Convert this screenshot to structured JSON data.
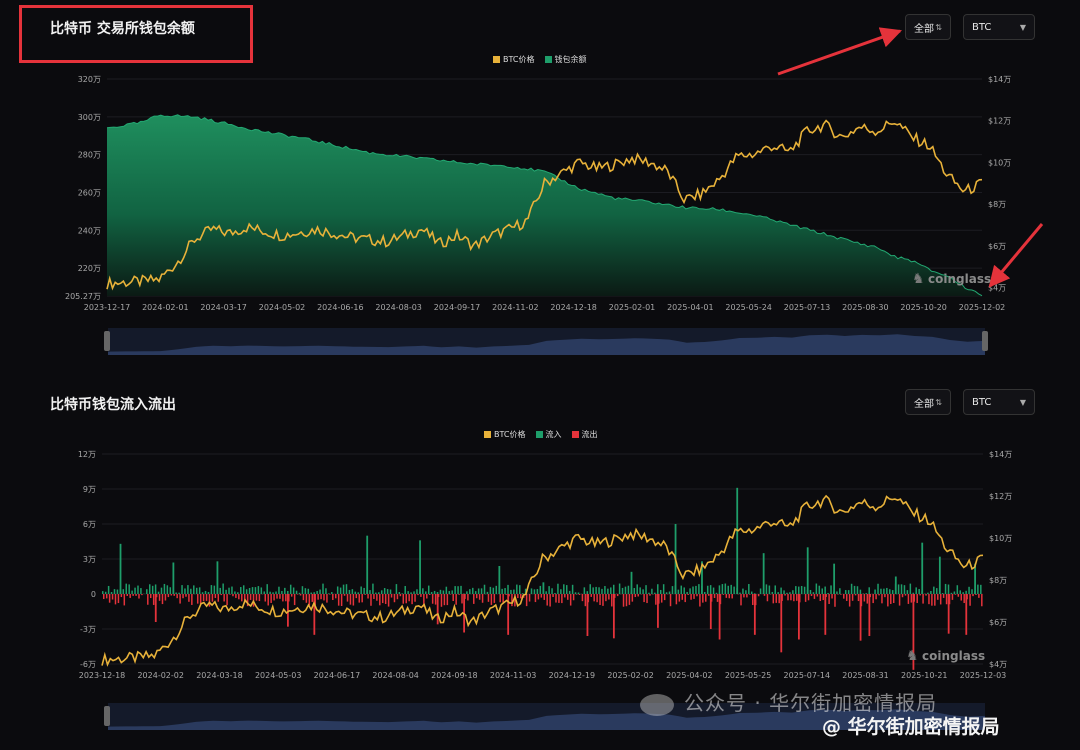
{
  "panel1": {
    "title": "比特币 交易所钱包余额",
    "range_select": "全部",
    "asset_select": "BTC",
    "legend": [
      {
        "label": "BTC价格",
        "color": "#e8b23a"
      },
      {
        "label": "钱包余额",
        "color": "#1e9e6a"
      }
    ],
    "watermark": "coinglass"
  },
  "panel2": {
    "title": "比特币钱包流入流出",
    "range_select": "全部",
    "asset_select": "BTC",
    "legend": [
      {
        "label": "BTC价格",
        "color": "#e8b23a"
      },
      {
        "label": "流入",
        "color": "#1e9e6a"
      },
      {
        "label": "流出",
        "color": "#e5333b"
      }
    ],
    "watermark": "coinglass"
  },
  "footer": {
    "watermark_text": "公众号 · 华尔街加密情报局",
    "handle": "@ 华尔街加密情报局"
  },
  "colors": {
    "price": "#e8b23a",
    "balance": "#1e9e6a",
    "inflow": "#1e9e6a",
    "outflow": "#e5333b",
    "annotation": "#e5333b"
  },
  "chart_data": [
    {
      "type": "area",
      "title": "比特币 交易所钱包余额",
      "y_left_ticks": [
        "205.27万",
        "220万",
        "240万",
        "260万",
        "280万",
        "300万",
        "320万"
      ],
      "y_right_ticks": [
        "$4万",
        "$6万",
        "$8万",
        "$10万",
        "$12万",
        "$14万"
      ],
      "x_ticks": [
        "2023-12-17",
        "2024-02-01",
        "2024-03-17",
        "2024-05-02",
        "2024-06-16",
        "2024-08-03",
        "2024-09-17",
        "2024-11-02",
        "2024-12-18",
        "2025-02-01",
        "2025-04-01",
        "2025-05-24",
        "2025-07-13",
        "2025-08-30",
        "2025-10-20",
        "2025-12-02"
      ],
      "ylim_left": [
        205.27,
        320
      ],
      "ylim_right": [
        3.6,
        14
      ],
      "series": [
        {
          "name": "钱包余额",
          "axis": "left",
          "unit": "万",
          "x": [
            0,
            0.04,
            0.06,
            0.1,
            0.14,
            0.18,
            0.22,
            0.26,
            0.3,
            0.34,
            0.38,
            0.42,
            0.46,
            0.5,
            0.54,
            0.58,
            0.62,
            0.66,
            0.7,
            0.74,
            0.78,
            0.82,
            0.86,
            0.88,
            0.9,
            0.92,
            0.94,
            0.96,
            0.98,
            1
          ],
          "values": [
            294,
            297,
            301,
            300,
            296,
            292,
            289,
            285,
            281,
            279,
            277,
            275,
            274,
            271,
            262,
            257,
            255,
            252,
            251,
            248,
            243,
            238,
            233,
            231,
            226,
            224,
            219,
            216,
            210,
            206
          ]
        },
        {
          "name": "BTC价格",
          "axis": "right",
          "unit": "万美元",
          "x": [
            0,
            0.04,
            0.06,
            0.08,
            0.1,
            0.12,
            0.14,
            0.16,
            0.2,
            0.24,
            0.28,
            0.32,
            0.36,
            0.38,
            0.4,
            0.42,
            0.44,
            0.46,
            0.48,
            0.5,
            0.52,
            0.54,
            0.56,
            0.58,
            0.6,
            0.62,
            0.64,
            0.66,
            0.68,
            0.7,
            0.72,
            0.74,
            0.76,
            0.78,
            0.8,
            0.82,
            0.84,
            0.86,
            0.88,
            0.9,
            0.92,
            0.94,
            0.96,
            0.98,
            1
          ],
          "values": [
            4.2,
            4.3,
            4.4,
            5.2,
            6.3,
            6.8,
            6.6,
            6.9,
            6.5,
            6.8,
            6.4,
            6.2,
            6.8,
            6.1,
            6.5,
            6.0,
            6.5,
            6.8,
            7.2,
            9.0,
            9.5,
            10.0,
            9.7,
            9.9,
            10.2,
            10.0,
            9.6,
            8.2,
            8.5,
            9.2,
            10.3,
            10.4,
            10.8,
            10.5,
            11.5,
            11.8,
            11.2,
            11.7,
            11.5,
            12.0,
            11.2,
            10.8,
            9.4,
            8.6,
            9.0
          ]
        }
      ]
    },
    {
      "type": "bar",
      "title": "比特币钱包流入流出",
      "y_left_ticks": [
        "-6万",
        "-3万",
        "0",
        "3万",
        "6万",
        "9万",
        "12万"
      ],
      "y_right_ticks": [
        "$4万",
        "$6万",
        "$8万",
        "$10万",
        "$12万",
        "$14万"
      ],
      "x_ticks": [
        "2023-12-18",
        "2024-02-02",
        "2024-03-18",
        "2024-05-03",
        "2024-06-17",
        "2024-08-04",
        "2024-09-18",
        "2024-11-03",
        "2024-12-19",
        "2025-02-02",
        "2025-04-02",
        "2025-05-25",
        "2025-07-14",
        "2025-08-31",
        "2025-10-21",
        "2025-12-03"
      ],
      "ylim_left": [
        -6,
        12
      ],
      "ylim_right": [
        4,
        14
      ],
      "series": [
        {
          "name": "流入",
          "unit": "万",
          "x": [
            0.02,
            0.08,
            0.13,
            0.3,
            0.36,
            0.45,
            0.5,
            0.6,
            0.65,
            0.68,
            0.72,
            0.75,
            0.8,
            0.83,
            0.9,
            0.93,
            0.95,
            0.99
          ],
          "values": [
            4.3,
            2.7,
            2.8,
            5.0,
            4.6,
            2.4,
            1.0,
            1.9,
            6.0,
            2.8,
            9.1,
            3.5,
            4.0,
            2.6,
            1.5,
            4.4,
            3.2,
            2.6
          ]
        },
        {
          "name": "流出",
          "unit": "万",
          "x": [
            0.06,
            0.21,
            0.24,
            0.38,
            0.41,
            0.46,
            0.55,
            0.58,
            0.63,
            0.69,
            0.7,
            0.74,
            0.77,
            0.79,
            0.82,
            0.86,
            0.87,
            0.92,
            0.96,
            0.98
          ],
          "values": [
            -2.4,
            -2.8,
            -3.5,
            -2.6,
            -3.3,
            -3.5,
            -3.6,
            -3.8,
            -2.9,
            -3.0,
            -3.9,
            -3.5,
            -5.0,
            -3.9,
            -3.5,
            -4.0,
            -3.6,
            -6.5,
            -3.4,
            -3.5
          ]
        },
        {
          "name": "BTC价格",
          "axis": "right",
          "unit": "万美元",
          "x": [
            0,
            0.04,
            0.06,
            0.08,
            0.1,
            0.12,
            0.14,
            0.16,
            0.2,
            0.24,
            0.28,
            0.32,
            0.36,
            0.38,
            0.4,
            0.42,
            0.44,
            0.46,
            0.48,
            0.5,
            0.52,
            0.54,
            0.56,
            0.58,
            0.6,
            0.62,
            0.64,
            0.66,
            0.68,
            0.7,
            0.72,
            0.74,
            0.76,
            0.78,
            0.8,
            0.82,
            0.84,
            0.86,
            0.88,
            0.9,
            0.92,
            0.94,
            0.96,
            0.98,
            1
          ],
          "values": [
            4.2,
            4.3,
            4.4,
            5.2,
            6.3,
            6.8,
            6.6,
            6.9,
            6.5,
            6.8,
            6.4,
            6.2,
            6.8,
            6.1,
            6.5,
            6.0,
            6.5,
            6.8,
            7.2,
            9.0,
            9.5,
            10.0,
            9.7,
            9.9,
            10.2,
            10.0,
            9.6,
            8.2,
            8.5,
            9.2,
            10.3,
            10.4,
            10.8,
            10.5,
            11.5,
            11.8,
            11.2,
            11.7,
            11.5,
            12.0,
            11.2,
            10.8,
            9.4,
            8.6,
            9.0
          ]
        }
      ]
    }
  ]
}
